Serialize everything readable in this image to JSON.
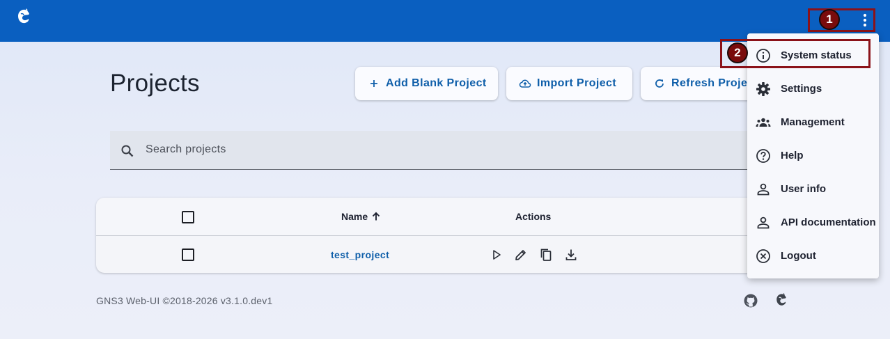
{
  "app": {
    "logo_icon": "gns3-logo-icon",
    "menu_icon": "more-vert-icon"
  },
  "page": {
    "title": "Projects"
  },
  "toolbar": {
    "add_blank": "Add Blank Project",
    "import": "Import Project",
    "refresh": "Refresh Project"
  },
  "search": {
    "placeholder": "Search projects"
  },
  "table": {
    "headers": {
      "name": "Name",
      "actions": "Actions"
    },
    "rows": [
      {
        "name": "test_project",
        "actions": [
          "play-icon",
          "edit-icon",
          "copy-icon",
          "download-icon"
        ]
      }
    ]
  },
  "footer": {
    "text": "GNS3 Web-UI ©2018-2026 v3.1.0.dev1",
    "icons": [
      "github-icon",
      "gns3-logo-icon"
    ]
  },
  "menu": {
    "items": [
      {
        "label": "System status",
        "icon": "info-icon"
      },
      {
        "label": "Settings",
        "icon": "gear-icon"
      },
      {
        "label": "Management",
        "icon": "group-icon"
      },
      {
        "label": "Help",
        "icon": "help-icon"
      },
      {
        "label": "User info",
        "icon": "person-icon"
      },
      {
        "label": "API documentation",
        "icon": "person-icon"
      },
      {
        "label": "Logout",
        "icon": "close-circle-icon"
      }
    ]
  },
  "annotations": {
    "step1": "1",
    "step2": "2"
  },
  "colors": {
    "topbar": "#0a5fc0",
    "accent": "#0e5ea9",
    "annotation": "#8b1219"
  }
}
